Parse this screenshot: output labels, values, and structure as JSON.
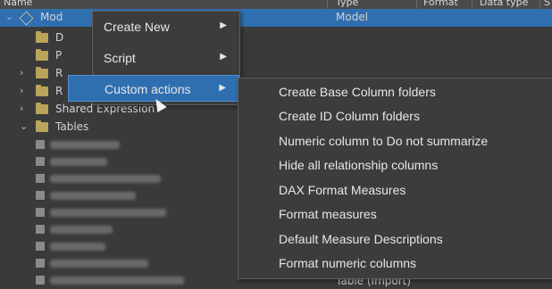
{
  "header": {
    "columns": [
      "Name",
      "Type",
      "Format",
      "Data type",
      "S"
    ]
  },
  "tree": {
    "model_label": "Mod",
    "model_type": "Model",
    "items": [
      {
        "label": "D"
      },
      {
        "label": "P"
      },
      {
        "label": "R"
      },
      {
        "label": "R"
      },
      {
        "label": "Shared Expression"
      },
      {
        "label": "Tables"
      }
    ],
    "bottom_type": "Table (Import)"
  },
  "context_menu": {
    "items": [
      {
        "label": "Create New"
      },
      {
        "label": "Script"
      },
      {
        "label": "Custom actions"
      }
    ]
  },
  "submenu": {
    "items": [
      {
        "label": "Create Base Column folders"
      },
      {
        "label": "Create ID Column folders"
      },
      {
        "label": "Numeric column to Do not summarize"
      },
      {
        "label": "Hide all relationship columns"
      },
      {
        "label": "DAX Format Measures"
      },
      {
        "label": "Format measures"
      },
      {
        "label": "Default Measure Descriptions"
      },
      {
        "label": "Format numeric columns"
      }
    ]
  },
  "colors": {
    "selection": "#2f6fb0",
    "menu_bg": "#3c3c3c",
    "folder": "#b9a55a"
  }
}
